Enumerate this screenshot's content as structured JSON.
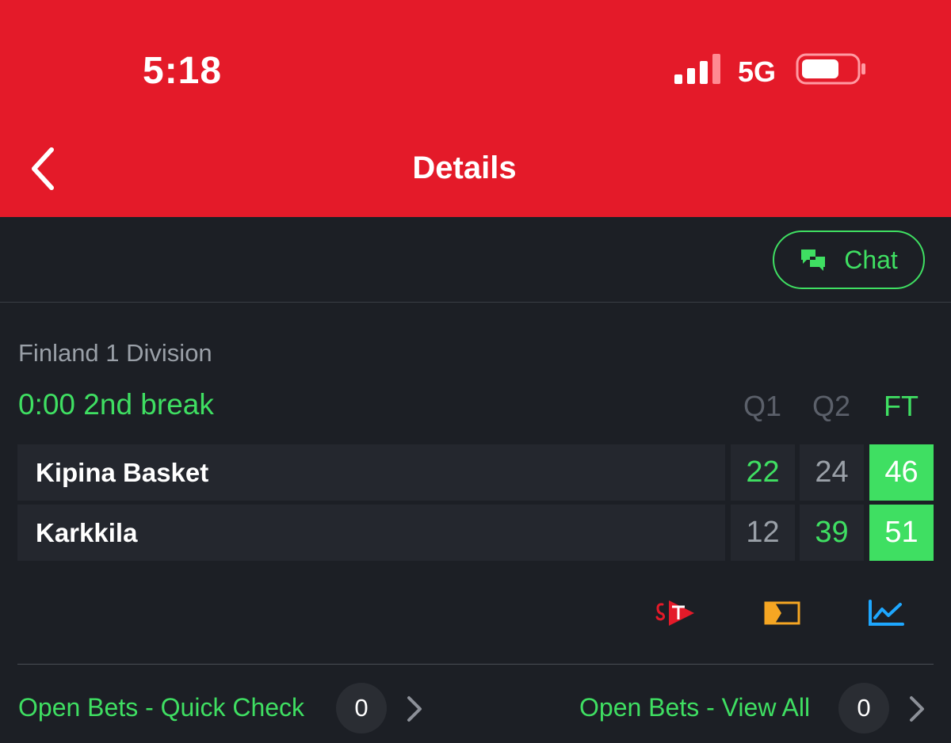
{
  "status_bar": {
    "time": "5:18",
    "network": "5G",
    "signal_icon": "cellular-signal-icon",
    "battery_icon": "battery-icon"
  },
  "nav": {
    "title": "Details",
    "back_icon": "chevron-left-icon"
  },
  "chat": {
    "label": "Chat",
    "icon": "chat-bubbles-icon"
  },
  "match": {
    "league": "Finland 1 Division",
    "status": "0:00 2nd break",
    "columns": [
      "Q1",
      "Q2",
      "FT"
    ],
    "teams": [
      {
        "name": "Kipina Basket",
        "scores": [
          "22",
          "24",
          "46"
        ]
      },
      {
        "name": "Karkkila",
        "scores": [
          "12",
          "39",
          "51"
        ]
      }
    ]
  },
  "media_icons": [
    "stv-streaming-icon",
    "match-tracker-icon",
    "statistics-chart-icon"
  ],
  "open_bets": {
    "quick_check_label": "Open Bets - Quick Check",
    "quick_check_count": "0",
    "view_all_label": "Open Bets - View All",
    "view_all_count": "0"
  },
  "colors": {
    "header_red": "#e41a29",
    "accent_green": "#3fdf62",
    "background": "#1c1f25",
    "row_background": "#24272e"
  }
}
